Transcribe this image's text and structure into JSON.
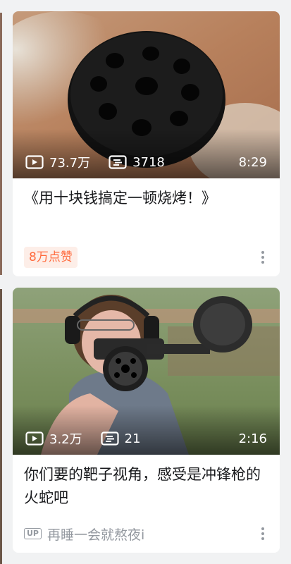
{
  "feed": {
    "cards": [
      {
        "views": "73.7万",
        "danmaku": "3718",
        "duration": "8:29",
        "title": "《用十块钱搞定一顿烧烤！》",
        "likes_badge": "8万点赞",
        "play_icon": "play-icon",
        "danmaku_icon": "danmaku-icon",
        "more_icon": "more-vertical-icon"
      },
      {
        "views": "3.2万",
        "danmaku": "21",
        "duration": "2:16",
        "title": "你们要的靶子视角，感受是冲锋枪的火蛇吧",
        "up_label": "UP",
        "author": "再睡一会就熬夜i",
        "play_icon": "play-icon",
        "danmaku_icon": "danmaku-icon",
        "more_icon": "more-vertical-icon"
      }
    ]
  },
  "colors": {
    "page_bg": "#f1f2f3",
    "card_bg": "#ffffff",
    "badge_text": "#ff6a3d",
    "badge_bg": "#fdeee8",
    "muted": "#9499a0"
  }
}
